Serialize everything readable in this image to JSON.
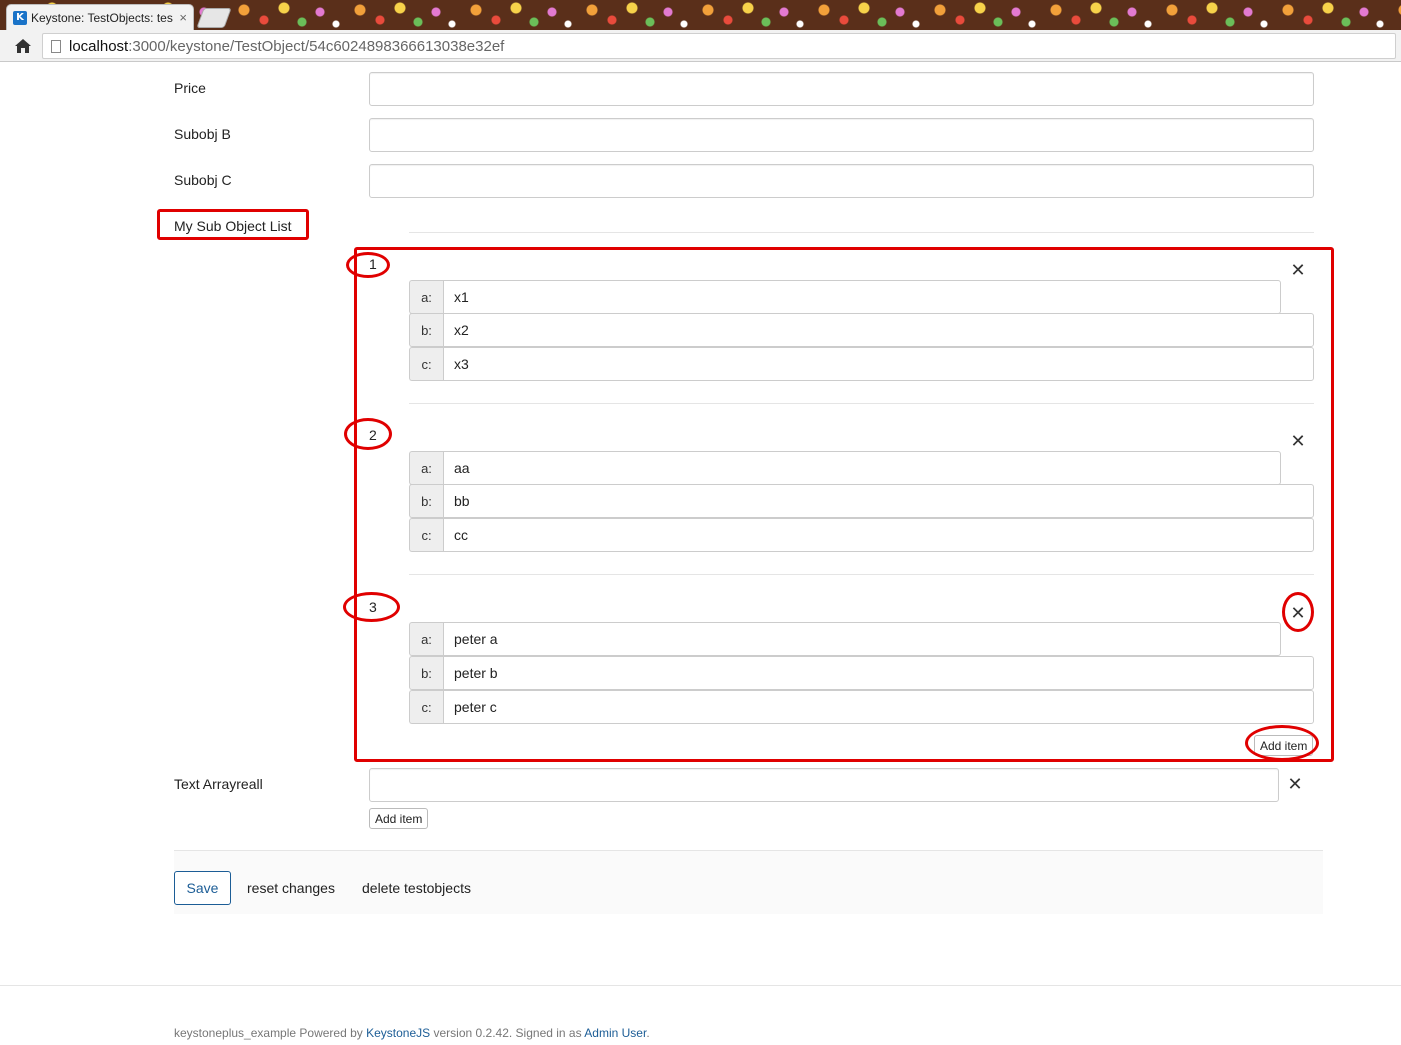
{
  "browser": {
    "tab_title": "Keystone: TestObjects: tes",
    "tab_favicon": "K",
    "tab_close": "×",
    "url_host": "localhost",
    "url_path": ":3000/keystone/TestObject/54c6024898366613038e32ef"
  },
  "form": {
    "price_label": "Price",
    "subobj_b_label": "Subobj B",
    "subobj_c_label": "Subobj C",
    "sublist_label": "My Sub Object List",
    "items": [
      {
        "num": "1",
        "a_key": "a:",
        "a": "x1",
        "b_key": "b:",
        "b": "x2",
        "c_key": "c:",
        "c": "x3"
      },
      {
        "num": "2",
        "a_key": "a:",
        "a": "aa",
        "b_key": "b:",
        "b": "bb",
        "c_key": "c:",
        "c": "cc"
      },
      {
        "num": "3",
        "a_key": "a:",
        "a": "peter a",
        "b_key": "b:",
        "b": "peter b",
        "c_key": "c:",
        "c": "peter c"
      }
    ],
    "remove_glyph": "✕",
    "add_item_label": "Add item",
    "text_array_label": "Text Arrayreall",
    "text_array_add_label": "Add item"
  },
  "actions": {
    "save": "Save",
    "reset": "reset changes",
    "delete": "delete testobjects"
  },
  "footer": {
    "prefix": "keystoneplus_example Powered by ",
    "keystone_link": "KeystoneJS",
    "middle": " version 0.2.42. Signed in as ",
    "user_link": "Admin User",
    "suffix": "."
  },
  "colors": {
    "annotation_red": "#e00000",
    "link_blue": "#1c5d96"
  }
}
